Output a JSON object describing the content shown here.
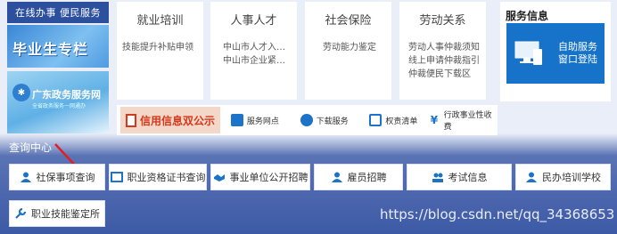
{
  "left": {
    "online_label": "在线办事 便民服务",
    "grad_banner_text": "毕业生专栏",
    "gov_banner_title": "广东政务服务网",
    "gov_banner_sub": "全省政务服务一网通办"
  },
  "cards": [
    {
      "title": "就业培训",
      "lines": [
        "技能提升补贴申领"
      ]
    },
    {
      "title": "人事人才",
      "lines": [
        "中山市人才入户...",
        "中山市企业紧缺..."
      ]
    },
    {
      "title": "社会保险",
      "lines": [
        "劳动能力鉴定"
      ]
    },
    {
      "title": "劳动关系",
      "lines": [
        "劳动人事仲裁须知",
        "线上申请仲裁指引",
        "仲裁便民下载区"
      ]
    }
  ],
  "service_info": {
    "title": "服务信息",
    "button_label_1": "自助服务",
    "button_label_2": "窗口登陆"
  },
  "quick_links": {
    "credit": "信用信息双公示",
    "items": [
      "服务网点",
      "下载服务",
      "权责清单",
      "行政事业性收费"
    ]
  },
  "query": {
    "label": "查询中心",
    "buttons": [
      "社保事项查询",
      "职业资格证书查询",
      "事业单位公开招聘",
      "雇员招聘",
      "考试信息",
      "民办培训学校",
      "职业技能鉴定所"
    ]
  },
  "watermark": "https://blog.csdn.net/qq_34368653",
  "colors": {
    "accent": "#1673c9",
    "header_bg": "#2c4f9e",
    "credit_text": "#d4391c"
  }
}
